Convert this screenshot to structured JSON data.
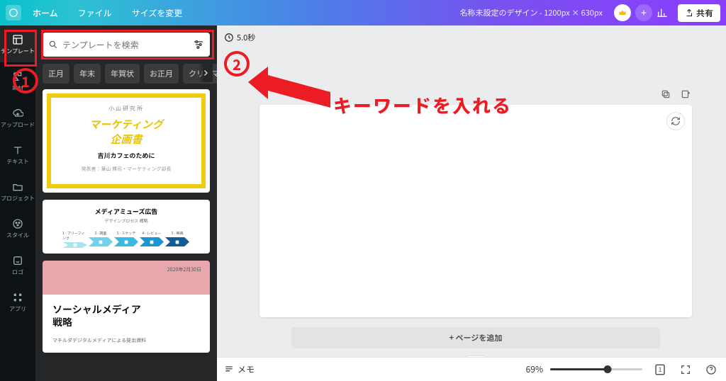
{
  "topbar": {
    "home": "ホーム",
    "file": "ファイル",
    "resize": "サイズを変更",
    "title": "名称未設定のデザイン - 1200px × 630px",
    "share": "共有"
  },
  "rail": {
    "items": [
      {
        "label": "テンプレート",
        "icon": "template"
      },
      {
        "label": "素材",
        "icon": "elements"
      },
      {
        "label": "アップロード",
        "icon": "upload"
      },
      {
        "label": "テキスト",
        "icon": "text"
      },
      {
        "label": "プロジェクト",
        "icon": "folder"
      },
      {
        "label": "スタイル",
        "icon": "style"
      },
      {
        "label": "ロゴ",
        "icon": "logo"
      },
      {
        "label": "アプリ",
        "icon": "apps"
      }
    ]
  },
  "panel": {
    "search_placeholder": "テンプレートを検索",
    "chips": [
      "正月",
      "年末",
      "年賀状",
      "お正月",
      "クリスマ"
    ]
  },
  "templates": {
    "a": {
      "kicker": "小山研究所",
      "title1": "マーケティング",
      "title2": "企画書",
      "subtitle": "吉川カフェのために",
      "byline": "発表者：葉山 博司・マーケティング部長"
    },
    "b": {
      "title": "メディアミューズ広告",
      "subtitle": "デザインプロセス 概略",
      "steps": [
        "1 - ブリーフィング",
        "2 - 調査",
        "3 - スケッチ",
        "4 - レビュー",
        "5 - 実践"
      ],
      "colors": [
        "#a9e3f2",
        "#6fd1ec",
        "#3cb9e0",
        "#1a97cf",
        "#0f5f96"
      ]
    },
    "c": {
      "date": "2020年2月30日",
      "title": "ソーシャルメディア\n戦略",
      "sub": "マチルダデジタルメディアによる提出資料"
    }
  },
  "canvas": {
    "duration": "5.0秒",
    "add_page": "+ ページを追加"
  },
  "bottom": {
    "notes": "メモ",
    "zoom": "69%",
    "page_indicator": "1"
  },
  "annotation": {
    "num1": "1",
    "num2": "2",
    "text": "キーワードを入れる"
  }
}
